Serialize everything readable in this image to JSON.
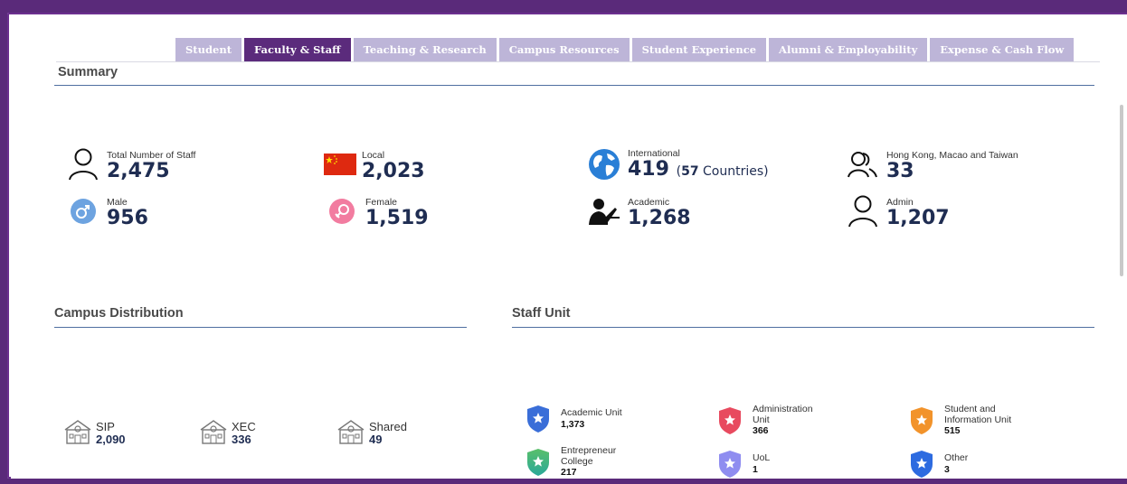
{
  "tabs": [
    {
      "label": "Student",
      "active": false
    },
    {
      "label": "Faculty & Staff",
      "active": true
    },
    {
      "label": "Teaching & Research",
      "active": false
    },
    {
      "label": "Campus Resources",
      "active": false
    },
    {
      "label": "Student Experience",
      "active": false
    },
    {
      "label": "Alumni & Employability",
      "active": false
    },
    {
      "label": "Expense & Cash Flow",
      "active": false
    }
  ],
  "summary": {
    "title": "Summary",
    "total": {
      "label": "Total Number of Staff",
      "value": "2,475",
      "icon": "person-outline-icon"
    },
    "local": {
      "label": "Local",
      "value": "2,023",
      "icon": "china-flag-icon"
    },
    "international": {
      "label": "International",
      "value": "419",
      "extra_num": "57",
      "extra_text": " Countries)",
      "icon": "globe-icon"
    },
    "hmt": {
      "label": "Hong Kong, Macao and Taiwan",
      "value": "33",
      "icon": "people-outline-icon"
    },
    "male": {
      "label": "Male",
      "value": "956",
      "icon": "male-icon"
    },
    "female": {
      "label": "Female",
      "value": "1,519",
      "icon": "female-icon"
    },
    "academic": {
      "label": "Academic",
      "value": "1,268",
      "icon": "teacher-icon"
    },
    "admin": {
      "label": "Admin",
      "value": "1,207",
      "icon": "person-outline-icon"
    }
  },
  "campus": {
    "title": "Campus Distribution",
    "items": [
      {
        "label": "SIP",
        "value": "2,090"
      },
      {
        "label": "XEC",
        "value": "336"
      },
      {
        "label": "Shared",
        "value": "49"
      }
    ]
  },
  "staff_unit": {
    "title": "Staff Unit",
    "items": [
      {
        "label": "Academic Unit",
        "value": "1,373",
        "color": "#3a6ed8"
      },
      {
        "label": "Administration Unit",
        "value": "366",
        "color": "#e84a5f"
      },
      {
        "label": "Student and Information Unit",
        "value": "515",
        "color": "#f2932b"
      },
      {
        "label": "Entrepreneur College",
        "value": "217",
        "color": "#3cbf7a"
      },
      {
        "label": "UoL",
        "value": "1",
        "color": "#8f8df0"
      },
      {
        "label": "Other",
        "value": "3",
        "color": "#2d6be0"
      }
    ]
  }
}
